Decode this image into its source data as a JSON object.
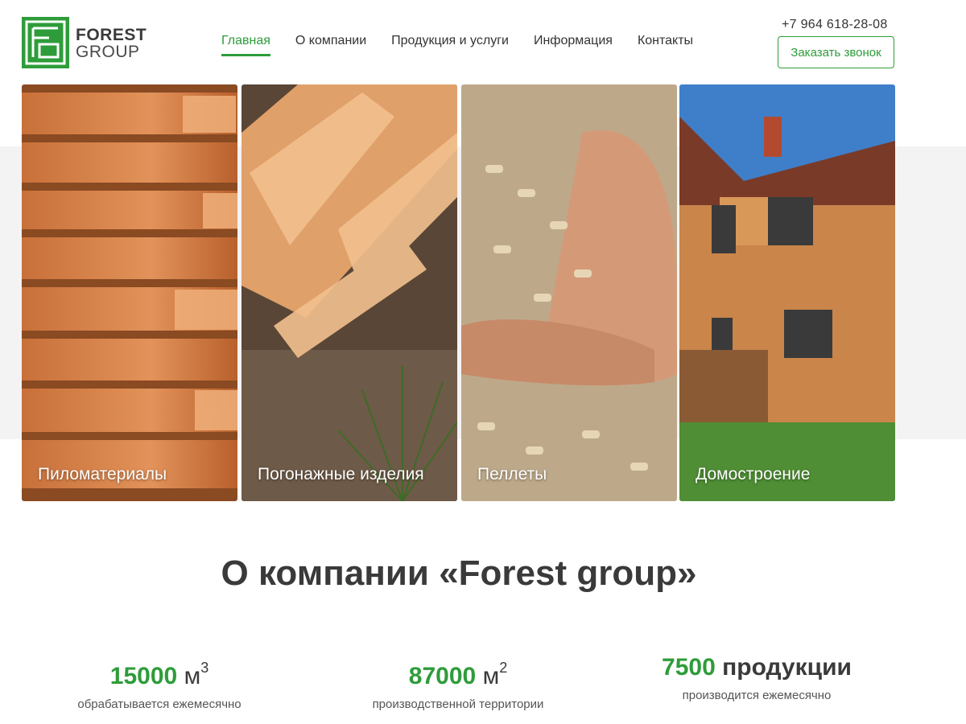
{
  "header": {
    "logo": {
      "line1": "FOREST",
      "line2": "GROUP"
    },
    "nav": [
      {
        "label": "Главная",
        "active": true
      },
      {
        "label": "О компании",
        "active": false
      },
      {
        "label": "Продукция и услуги",
        "active": false
      },
      {
        "label": "Информация",
        "active": false
      },
      {
        "label": "Контакты",
        "active": false
      }
    ],
    "phone": "+7 964 618-28-08",
    "callback_button": "Заказать звонок"
  },
  "products": [
    {
      "label": "Пиломатериалы",
      "image": "stacked-lumber-boards"
    },
    {
      "label": "Погонажные изделия",
      "image": "wooden-moldings"
    },
    {
      "label": "Пеллеты",
      "image": "wood-pellets-in-hands"
    },
    {
      "label": "Домостроение",
      "image": "wooden-house"
    }
  ],
  "about": {
    "title": "О компании «Forest group»",
    "stats": [
      {
        "value": "15000",
        "unit": "м",
        "sup": "3",
        "desc": "обрабатывается ежемесячно"
      },
      {
        "value": "87000",
        "unit": "м",
        "sup": "2",
        "desc": "производственной территории"
      },
      {
        "value": "7500",
        "unit": "продукции",
        "sup": "",
        "desc": "производится ежемесячно"
      }
    ]
  },
  "colors": {
    "accent": "#2e9c3a",
    "text": "#333333",
    "band": "#f3f3f3"
  }
}
